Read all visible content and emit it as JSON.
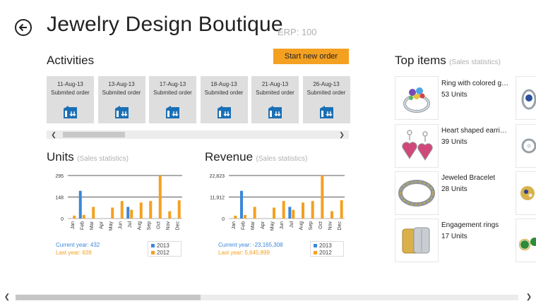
{
  "header": {
    "back_icon": "back-arrow-icon",
    "title": "Jewelry Design Boutique",
    "erp": "ERP: 100"
  },
  "activities": {
    "title": "Activities",
    "start_button": "Start new order",
    "tiles": [
      {
        "date": "11-Aug-13",
        "status": "Submited order",
        "icon": "order-icon"
      },
      {
        "date": "13-Aug-13",
        "status": "Submited order",
        "icon": "order-icon"
      },
      {
        "date": "17-Aug-13",
        "status": "Submited order",
        "icon": "order-icon"
      },
      {
        "date": "18-Aug-13",
        "status": "Submited order",
        "icon": "order-icon"
      },
      {
        "date": "21-Aug-13",
        "status": "Submited order",
        "icon": "order-icon"
      },
      {
        "date": "26-Aug-13",
        "status": "Submited order",
        "icon": "order-icon"
      }
    ],
    "accent_color": "#1b6fb5",
    "tile_color": "#dedede"
  },
  "units_section": {
    "title": "Units",
    "subtitle": "(Sales statistics)",
    "current_year": "Current year: 432",
    "last_year": "Last year: 639",
    "legend": [
      "2013",
      "2012"
    ]
  },
  "revenue_section": {
    "title": "Revenue",
    "subtitle": "(Sales statistics)",
    "current_year": "Current year: -23,165,308",
    "last_year": "Last year: 5,645,899",
    "legend": [
      "2013",
      "2012"
    ]
  },
  "chart_data": [
    {
      "type": "bar",
      "categories": [
        "Jan",
        "Feb",
        "Mar",
        "Apr",
        "May",
        "Jun",
        "Jul",
        "Aug",
        "Sep",
        "Oct",
        "Nov",
        "Dec"
      ],
      "ytick_labels": [
        "295",
        "148",
        "0"
      ],
      "ylim": [
        0,
        295
      ],
      "series": [
        {
          "name": "2013",
          "color": "#3b87d8",
          "values": [
            0,
            190,
            0,
            0,
            0,
            0,
            80,
            0,
            0,
            0,
            0,
            0
          ]
        },
        {
          "name": "2012",
          "color": "#f4a021",
          "values": [
            20,
            25,
            80,
            0,
            75,
            120,
            60,
            110,
            120,
            295,
            50,
            125
          ]
        }
      ]
    },
    {
      "type": "bar",
      "categories": [
        "Jan",
        "Feb",
        "Mar",
        "Apr",
        "May",
        "Jun",
        "Jul",
        "Aug",
        "Sep",
        "Oct",
        "Nov",
        "Dec"
      ],
      "ytick_labels": [
        "22,823",
        "11,912",
        "0"
      ],
      "ylim": [
        0,
        22823
      ],
      "series": [
        {
          "name": "2013",
          "color": "#3b87d8",
          "values": [
            0,
            14700,
            0,
            0,
            0,
            0,
            6200,
            0,
            0,
            0,
            0,
            0
          ]
        },
        {
          "name": "2012",
          "color": "#f4a021",
          "values": [
            1500,
            1900,
            6200,
            0,
            5800,
            9300,
            4600,
            8500,
            9300,
            22823,
            3900,
            9700
          ]
        }
      ]
    }
  ],
  "top_items": {
    "title": "Top items",
    "subtitle": "(Sales statistics)",
    "items": [
      {
        "name": "Ring with colored ge...",
        "units": "53 Units",
        "icon": "ring-colored-gems-image"
      },
      {
        "name": "Heart shaped earrings",
        "units": "39 Units",
        "icon": "heart-earrings-image"
      },
      {
        "name": "Jeweled Bracelet",
        "units": "28 Units",
        "icon": "bracelet-image"
      },
      {
        "name": "Engagement rings",
        "units": "17 Units",
        "icon": "engagement-rings-image"
      }
    ]
  }
}
